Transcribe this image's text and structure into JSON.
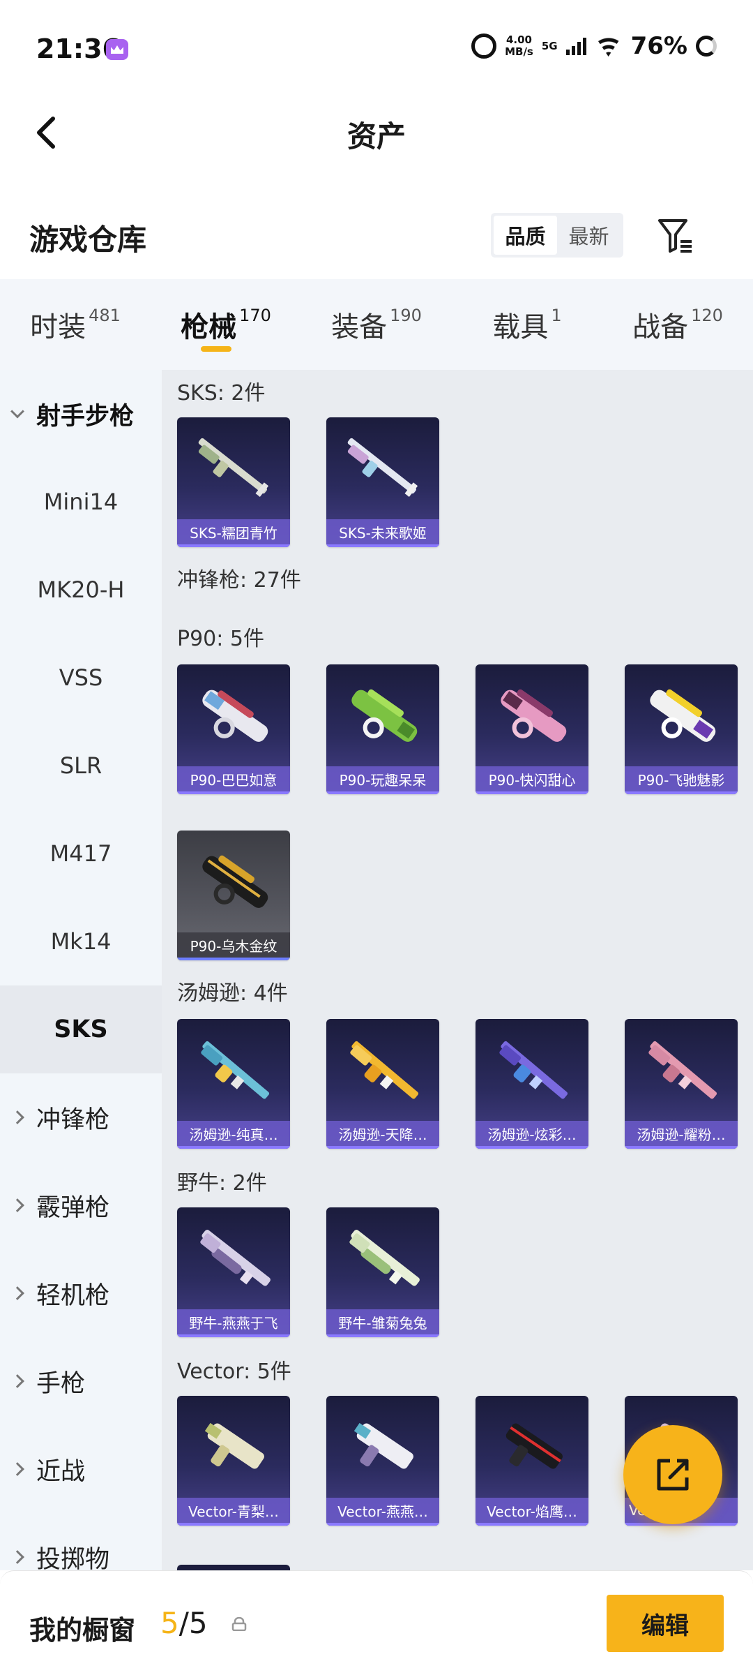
{
  "status": {
    "time": "21:36",
    "speed_value": "4.00",
    "speed_unit": "MB/s",
    "network": "5G",
    "battery": "76%"
  },
  "header": {
    "title": "资产"
  },
  "warehouse": {
    "title": "游戏仓库",
    "sort_options": [
      "品质",
      "最新"
    ],
    "sort_active": "品质"
  },
  "tabs": [
    {
      "label": "时装",
      "count": "481"
    },
    {
      "label": "枪械",
      "count": "170",
      "active": true
    },
    {
      "label": "装备",
      "count": "190"
    },
    {
      "label": "载具",
      "count": "1"
    },
    {
      "label": "战备",
      "count": "120"
    }
  ],
  "sidebar": {
    "group_open": "射手步枪",
    "sub_items": [
      "Mini14",
      "MK20-H",
      "VSS",
      "SLR",
      "M417",
      "Mk14",
      "SKS"
    ],
    "selected": "SKS",
    "groups": [
      "冲锋枪",
      "霰弹枪",
      "轻机枪",
      "手枪",
      "近战",
      "投掷物"
    ]
  },
  "content": {
    "sks_header": "SKS: 2件",
    "sks_items": [
      "SKS-糯团青竹",
      "SKS-未来歌姬"
    ],
    "smg_header": "冲锋枪: 27件",
    "p90_header": "P90: 5件",
    "p90_items": [
      "P90-巴巴如意",
      "P90-玩趣呆呆",
      "P90-快闪甜心",
      "P90-飞驰魅影",
      "P90-乌木金纹"
    ],
    "thompson_header": "汤姆逊: 4件",
    "thompson_items": [
      "汤姆逊-纯真…",
      "汤姆逊-天降…",
      "汤姆逊-炫彩…",
      "汤姆逊-耀粉…"
    ],
    "bison_header": "野牛: 2件",
    "bison_items": [
      "野牛-燕燕于飞",
      "野牛-雏菊兔兔"
    ],
    "vector_header": "Vector: 5件",
    "vector_items": [
      "Vector-青梨…",
      "Vector-燕燕…",
      "Vector-焰鹰…",
      "Vec…"
    ]
  },
  "bottom": {
    "title": "我的橱窗",
    "current": "5",
    "separator": "/",
    "total": "5",
    "edit_label": "编辑"
  },
  "colors": {
    "accent": "#f7b31a",
    "card_purple": "#47418a",
    "sidebar_bg": "#f2f6fa",
    "content_bg": "#e9ecf0"
  }
}
